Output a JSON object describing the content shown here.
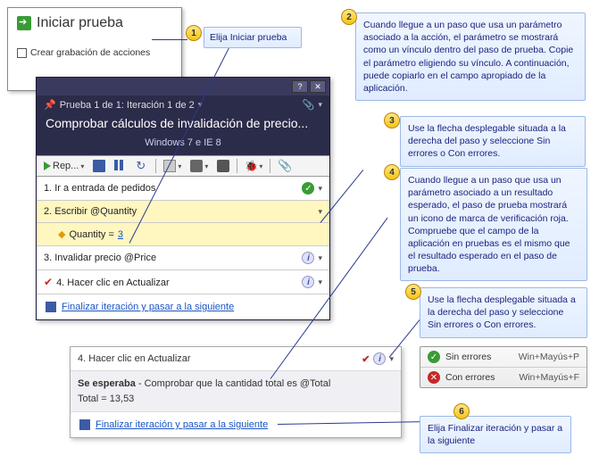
{
  "panelA": {
    "start_label": "Iniciar prueba",
    "checkbox_label": "Crear grabación de acciones"
  },
  "callouts": {
    "1": "Elija Iniciar prueba",
    "2": "Cuando llegue a un paso que usa un parámetro asociado a la acción, el parámetro se mostrará como un vínculo dentro del paso de prueba. Copie el parámetro eligiendo su vínculo. A continuación, puede copiarlo en el campo apropiado de la aplicación.",
    "3": "Use la flecha desplegable situada a la derecha del paso y seleccione Sin errores o Con errores.",
    "4": "Cuando llegue a un paso que usa un parámetro asociado a un resultado esperado, el paso de prueba mostrará un icono de marca de verificación roja. Compruebe que el campo de la aplicación en pruebas es el mismo que el resultado esperado en el paso de prueba.",
    "5": "Use la flecha desplegable situada a la derecha del paso y seleccione Sin errores o Con errores.",
    "6": "Elija Finalizar iteración y pasar a la siguiente"
  },
  "runner": {
    "breadcrumb": "Prueba 1 de 1: Iteración 1 de 2",
    "title": "Comprobar cálculos de invalidación de precio...",
    "env": "Windows 7 e IE 8",
    "toolbar": {
      "play_label": "Rep..."
    },
    "steps": [
      {
        "label": "1. Ir a entrada de pedidos"
      },
      {
        "label": "2. Escribir @Quantity"
      },
      {
        "label": "3. Invalidar precio @Price"
      },
      {
        "label": "4. Hacer clic en Actualizar"
      }
    ],
    "substep": {
      "key": "Quantity =",
      "value": "3"
    },
    "footer_link": "Finalizar iteración y pasar a la siguiente"
  },
  "expand": {
    "header": "4. Hacer clic en Actualizar",
    "expected_label": "Se esperaba",
    "expected_text": " - Comprobar que la cantidad total es @Total",
    "total_line": "Total = 13,53",
    "footer_link": "Finalizar iteración y pasar a la siguiente"
  },
  "legend": {
    "pass_label": "Sin errores",
    "pass_shortcut": "Win+Mayús+P",
    "fail_label": "Con errores",
    "fail_shortcut": "Win+Mayús+F"
  }
}
